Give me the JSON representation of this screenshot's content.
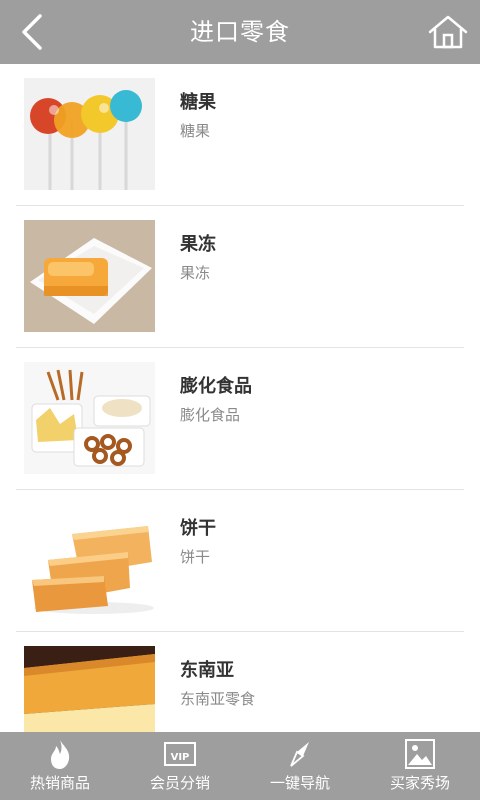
{
  "header": {
    "title": "进口零食",
    "back_icon": "chevron-left-icon",
    "home_icon": "home-icon"
  },
  "products": [
    {
      "name": "糖果",
      "description": "糖果",
      "image": "lollipops-photo"
    },
    {
      "name": "果冻",
      "description": "果冻",
      "image": "jelly-photo"
    },
    {
      "name": "膨化食品",
      "description": "膨化食品",
      "image": "puffed-snacks-photo"
    },
    {
      "name": "饼干",
      "description": "饼干",
      "image": "biscuits-photo"
    },
    {
      "name": "东南亚",
      "description": "东南亚零食",
      "image": "cheesecake-photo"
    }
  ],
  "tabbar": [
    {
      "label": "热销商品",
      "icon": "flame-icon"
    },
    {
      "label": "会员分销",
      "icon": "vip-card-icon"
    },
    {
      "label": "一键导航",
      "icon": "compass-icon"
    },
    {
      "label": "买家秀场",
      "icon": "picture-icon"
    }
  ],
  "colors": {
    "header_bg": "#9e9e9e",
    "tabbar_bg": "#9e9e9e",
    "title_text": "#ffffff",
    "name_text": "#333333",
    "desc_text": "#8a8a8a"
  }
}
